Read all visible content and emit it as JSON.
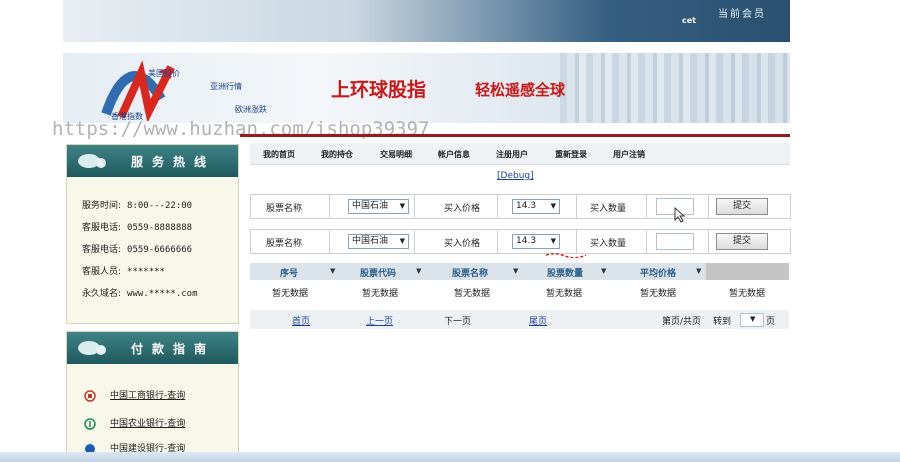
{
  "header": {
    "member_label": "当前会员",
    "user_name": "cet"
  },
  "banner": {
    "links": [
      "美国股价",
      "亚洲行情",
      "欧洲涨跌",
      "香港指数"
    ],
    "slogan_main": "上环球股指",
    "slogan_sub": "轻松遥感全球"
  },
  "watermark": "https://www.huzhan.com/ishop39397",
  "service_panel": {
    "title": "服务热线",
    "rows": [
      {
        "label": "服务时间:",
        "value": "8:00---22:00"
      },
      {
        "label": "客服电话:",
        "value": "0559-8888888"
      },
      {
        "label": "客服电话:",
        "value": "0559-6666666"
      },
      {
        "label": "客服人员:",
        "value": "*******"
      },
      {
        "label": "永久域名:",
        "value": "www.*****.com"
      }
    ]
  },
  "payment_panel": {
    "title": "付款指南",
    "banks": [
      "中国工商银行-查询",
      "中国农业银行-查询",
      "中国建设银行-查询"
    ]
  },
  "nav": [
    "我的首页",
    "我的持仓",
    "交易明细",
    "帐户信息",
    "注册用户",
    "重新登录",
    "用户注销"
  ],
  "debug_link": "[Debug]",
  "trade_form": {
    "stock_name_label": "股票名称",
    "stock_value": "中国石油",
    "price_label": "买入价格",
    "price_value": "14.3",
    "qty_label": "买入数量",
    "submit_label": "提交"
  },
  "table": {
    "headers": [
      "序号",
      "股票代码",
      "股票名称",
      "股票数量",
      "平均价格"
    ],
    "empty_text": "暂无数据"
  },
  "pager": {
    "first": "首页",
    "prev": "上一页",
    "next": "下一页",
    "last": "尾页",
    "page_info": "第页/共页",
    "goto": "转到",
    "page_suffix": "页"
  },
  "colors": {
    "panel_head": "#2e6f73",
    "accent_red": "#c91818",
    "link_blue": "#1d3f9e"
  }
}
